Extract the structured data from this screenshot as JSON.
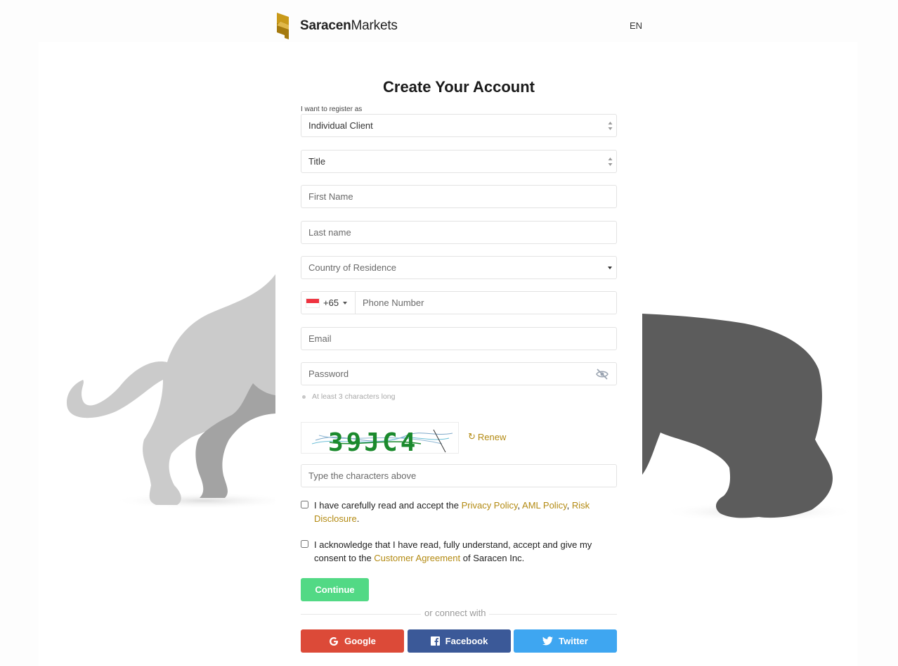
{
  "brand": {
    "name_bold": "Saracen",
    "name_light": "Markets",
    "gold": "#c99a1a",
    "gold_dark": "#a57a0e",
    "link_color": "#b38a12"
  },
  "header": {
    "language": "EN"
  },
  "form": {
    "title": "Create Your Account",
    "register_as_label": "I want to register as",
    "register_as_value": "Individual Client",
    "title_select": "Title",
    "first_name_placeholder": "First Name",
    "last_name_placeholder": "Last name",
    "country_placeholder": "Country of Residence",
    "phone_prefix": "+65",
    "phone_placeholder": "Phone Number",
    "email_placeholder": "Email",
    "password_placeholder": "Password",
    "password_hint": "At least 3 characters long",
    "captcha_text": "39JC4",
    "renew_label": "Renew",
    "captcha_placeholder": "Type the characters above",
    "consent1": {
      "prefix": "I have carefully read and accept the ",
      "privacy": "Privacy Policy",
      "sep1": ", ",
      "aml": "AML Policy",
      "sep2": ", ",
      "risk": "Risk Disclosure",
      "suffix": "."
    },
    "consent2": {
      "prefix": "I acknowledge that I have read, fully understand, accept and give my consent to the ",
      "agreement": "Customer Agreement",
      "suffix": " of Saracen Inc."
    },
    "continue_label": "Continue",
    "connect_with": "or connect with"
  },
  "social": {
    "google": "Google",
    "facebook": "Facebook",
    "twitter": "Twitter",
    "colors": {
      "google": "#dc4a38",
      "facebook": "#3b5998",
      "twitter": "#3ea6f1",
      "continue": "#52d985"
    }
  },
  "icons": [
    "logo-icon",
    "select-arrows-icon",
    "caret-down-icon",
    "singapore-flag-icon",
    "eye-slash-icon",
    "refresh-icon",
    "google-icon",
    "facebook-icon",
    "twitter-icon"
  ]
}
